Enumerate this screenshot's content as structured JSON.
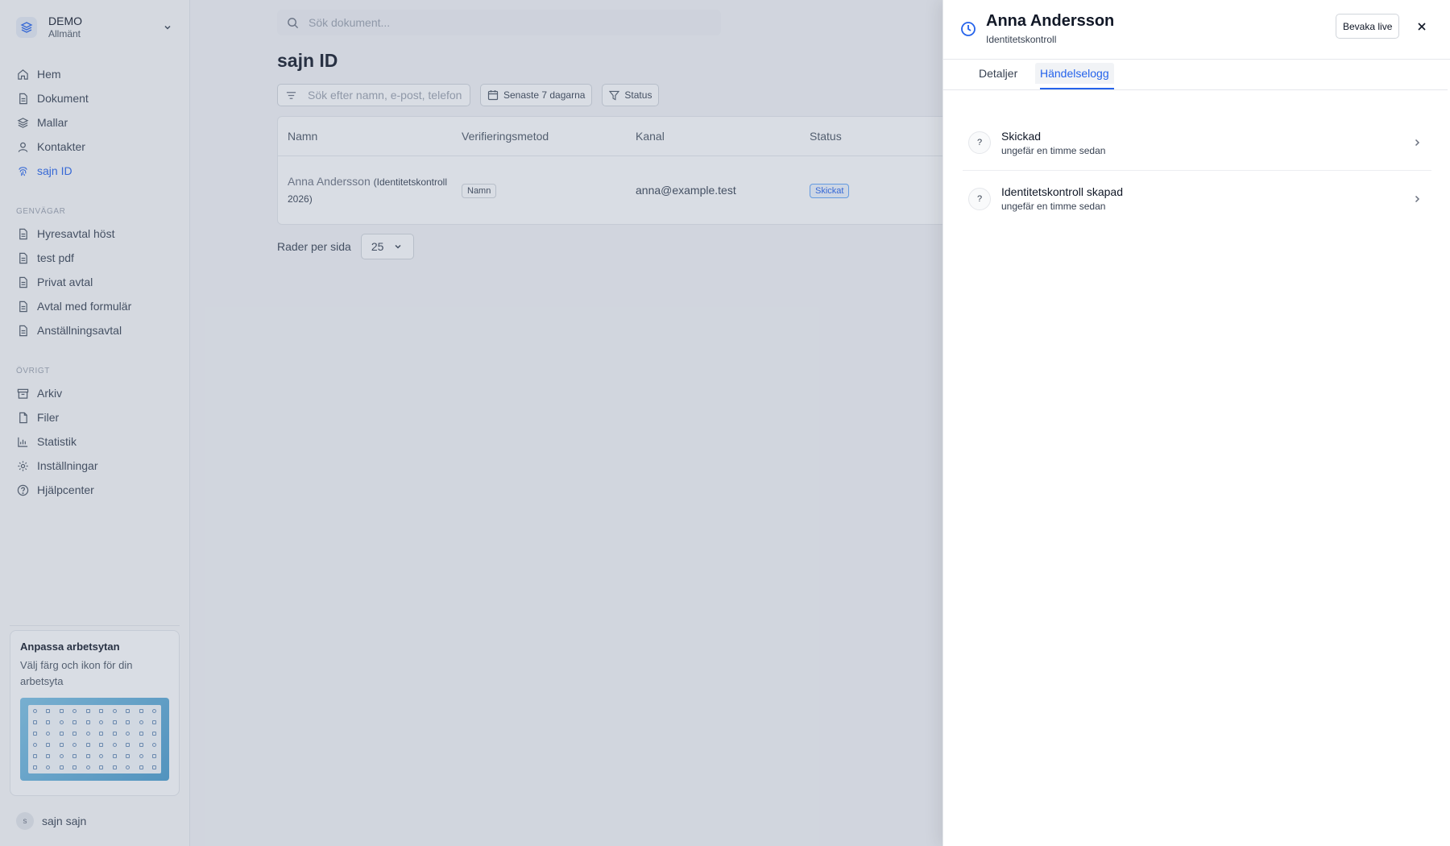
{
  "workspace": {
    "name": "DEMO",
    "subtitle": "Allmänt"
  },
  "nav": [
    {
      "label": "Hem",
      "icon": "home-icon"
    },
    {
      "label": "Dokument",
      "icon": "document-icon"
    },
    {
      "label": "Mallar",
      "icon": "layers-icon"
    },
    {
      "label": "Kontakter",
      "icon": "user-icon"
    },
    {
      "label": "sajn ID",
      "icon": "fingerprint-icon",
      "active": true
    }
  ],
  "shortcuts": {
    "label": "Genvägar",
    "items": [
      {
        "label": "Hyresavtal höst"
      },
      {
        "label": "test pdf"
      },
      {
        "label": "Privat avtal"
      },
      {
        "label": "Avtal med formulär"
      },
      {
        "label": "Anställningsavtal"
      }
    ]
  },
  "other": {
    "label": "Övrigt",
    "items": [
      {
        "label": "Arkiv",
        "icon": "archive-icon"
      },
      {
        "label": "Filer",
        "icon": "file-icon"
      },
      {
        "label": "Statistik",
        "icon": "chart-icon"
      },
      {
        "label": "Inställningar",
        "icon": "gear-icon"
      },
      {
        "label": "Hjälpcenter",
        "icon": "help-icon"
      }
    ]
  },
  "promo": {
    "title": "Anpassa arbetsytan",
    "text": "Välj färg och ikon för din arbetsyta"
  },
  "user": {
    "initial": "s",
    "name": "sajn sajn"
  },
  "search": {
    "placeholder": "Sök dokument..."
  },
  "page": {
    "title": "sajn ID"
  },
  "filters": {
    "search_placeholder": "Sök efter namn, e-post, telefon",
    "date_label": "Senaste 7 dagarna",
    "status_label": "Status"
  },
  "table": {
    "columns": [
      "Namn",
      "Verifieringsmetod",
      "Kanal",
      "Status"
    ],
    "rows": [
      {
        "name": "Anna Andersson",
        "note": "(Identitetskontroll 2026)",
        "method": "Namn",
        "channel": "anna@example.test",
        "status": "Skickat"
      }
    ]
  },
  "pager": {
    "label": "Rader per sida",
    "value": "25"
  },
  "drawer": {
    "title": "Anna Andersson",
    "subtitle": "Identitetskontroll",
    "live_label": "Bevaka live",
    "tabs": [
      "Detaljer",
      "Händelselogg"
    ],
    "active_tab": "Händelselogg",
    "events": [
      {
        "icon": "?",
        "title": "Skickad",
        "time": "ungefär en timme sedan"
      },
      {
        "icon": "?",
        "title": "Identitetskontroll skapad",
        "time": "ungefär en timme sedan"
      }
    ]
  },
  "colors": {
    "accent": "#2563eb",
    "overlay": "#6e7d96"
  }
}
